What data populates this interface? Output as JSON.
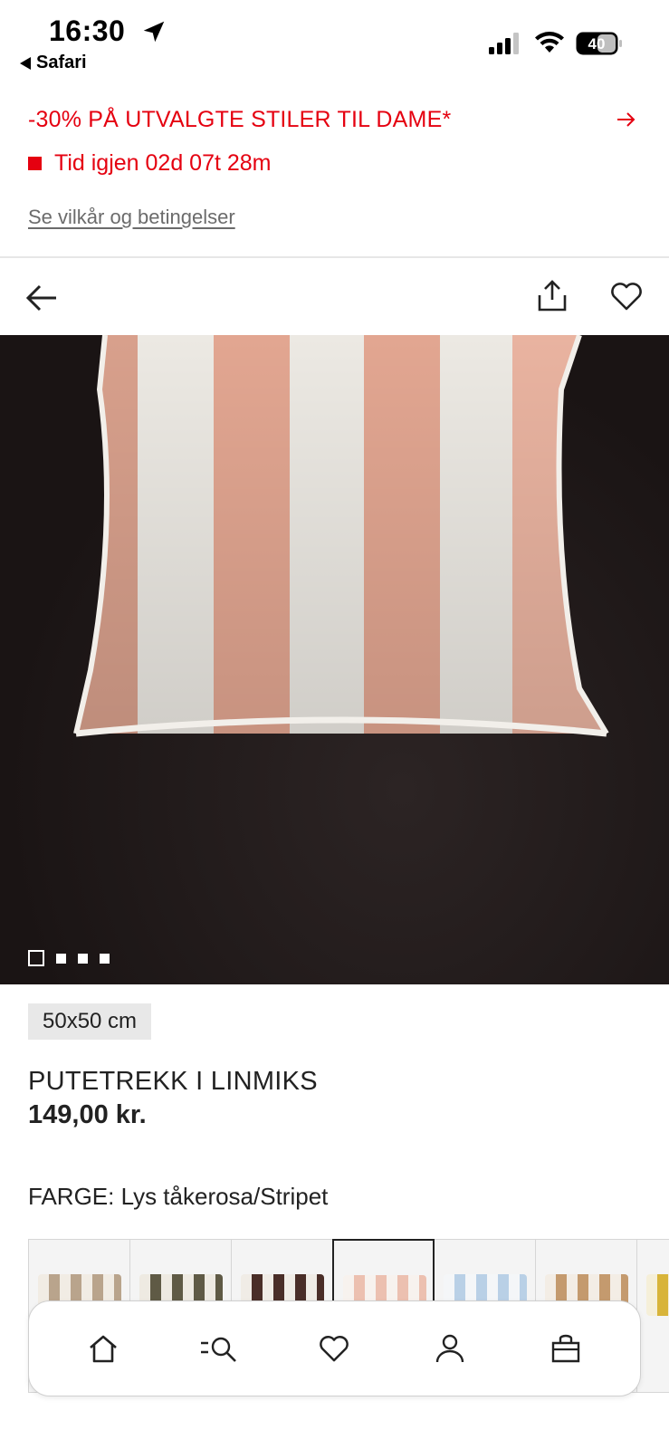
{
  "status_bar": {
    "time": "16:30",
    "back_app": "Safari",
    "battery": "40"
  },
  "promo": {
    "title": "-30% PÅ UTVALGTE STILER TIL DAME*",
    "countdown": "Tid igjen 02d 07t 28m",
    "terms_link": "Se vilkår og betingelser",
    "accent_color": "#e50010"
  },
  "toolbar": {
    "back_icon": "arrow-left-icon",
    "share_icon": "share-icon",
    "favorite_icon": "heart-icon"
  },
  "gallery": {
    "image_count": 4,
    "active_index": 0
  },
  "product": {
    "size": "50x50 cm",
    "name": "PUTETREKK I LINMIKS",
    "price": "149,00 kr.",
    "color_label": "FARGE: Lys tåkerosa/Stripet"
  },
  "swatches": [
    {
      "stripe": "#b9a48c",
      "base": "#f1ece4",
      "selected": false
    },
    {
      "stripe": "#5f5a45",
      "base": "#eeeae2",
      "selected": false
    },
    {
      "stripe": "#4a2e28",
      "base": "#f0ece6",
      "selected": false
    },
    {
      "stripe": "#ecc0b0",
      "base": "#f7f2ee",
      "selected": true
    },
    {
      "stripe": "#b9d0e6",
      "base": "#f4f6f8",
      "selected": false
    },
    {
      "stripe": "#c49a6e",
      "base": "#f3ede5",
      "selected": false
    },
    {
      "stripe": "#d8b43a",
      "base": "#f5efd9",
      "selected": false
    }
  ],
  "bottom_nav": [
    {
      "icon": "home-icon"
    },
    {
      "icon": "search-icon"
    },
    {
      "icon": "heart-icon"
    },
    {
      "icon": "account-icon"
    },
    {
      "icon": "bag-icon"
    }
  ]
}
